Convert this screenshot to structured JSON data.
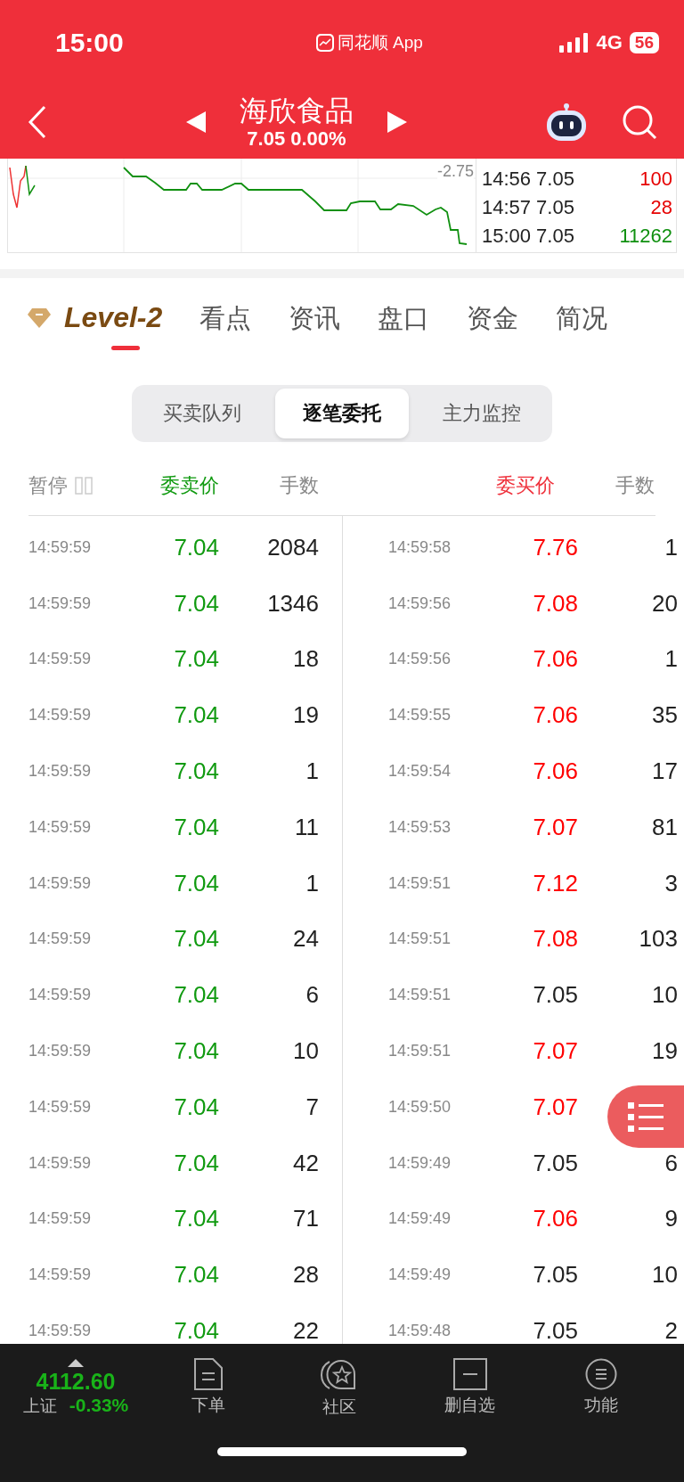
{
  "status_bar": {
    "time": "15:00",
    "app_label": "同花顺 App",
    "network": "4G",
    "battery": "56"
  },
  "header": {
    "title": "海欣食品",
    "subtitle": "7.05 0.00%"
  },
  "chart": {
    "axis_label": "-2.75",
    "ticks": [
      {
        "time": "14:56",
        "price": "7.05",
        "volume": "100",
        "color": "#e60000"
      },
      {
        "time": "14:57",
        "price": "7.05",
        "volume": "28",
        "color": "#e60000"
      },
      {
        "time": "15:00",
        "price": "7.05",
        "volume": "11262",
        "color": "#109010"
      }
    ]
  },
  "tabs": [
    {
      "label": "Level-2",
      "kind": "premium",
      "selected": true
    },
    {
      "label": "看点",
      "kind": "plain",
      "selected": false
    },
    {
      "label": "资讯",
      "kind": "plain",
      "selected": false
    },
    {
      "label": "盘口",
      "kind": "plain",
      "selected": false
    },
    {
      "label": "资金",
      "kind": "plain",
      "selected": false
    },
    {
      "label": "简况",
      "kind": "plain",
      "selected": false
    }
  ],
  "segments": [
    {
      "label": "买卖队列",
      "selected": false
    },
    {
      "label": "逐笔委托",
      "selected": true
    },
    {
      "label": "主力监控",
      "selected": false
    }
  ],
  "columns": {
    "pause": "暂停",
    "sell_price": "委卖价",
    "sell_qty": "手数",
    "buy_price": "委买价",
    "buy_qty": "手数"
  },
  "sell_orders": [
    {
      "time": "14:59:59",
      "price": "7.04",
      "qty": "2084"
    },
    {
      "time": "14:59:59",
      "price": "7.04",
      "qty": "1346"
    },
    {
      "time": "14:59:59",
      "price": "7.04",
      "qty": "18"
    },
    {
      "time": "14:59:59",
      "price": "7.04",
      "qty": "19"
    },
    {
      "time": "14:59:59",
      "price": "7.04",
      "qty": "1"
    },
    {
      "time": "14:59:59",
      "price": "7.04",
      "qty": "11"
    },
    {
      "time": "14:59:59",
      "price": "7.04",
      "qty": "1"
    },
    {
      "time": "14:59:59",
      "price": "7.04",
      "qty": "24"
    },
    {
      "time": "14:59:59",
      "price": "7.04",
      "qty": "6"
    },
    {
      "time": "14:59:59",
      "price": "7.04",
      "qty": "10"
    },
    {
      "time": "14:59:59",
      "price": "7.04",
      "qty": "7"
    },
    {
      "time": "14:59:59",
      "price": "7.04",
      "qty": "42"
    },
    {
      "time": "14:59:59",
      "price": "7.04",
      "qty": "71"
    },
    {
      "time": "14:59:59",
      "price": "7.04",
      "qty": "28"
    },
    {
      "time": "14:59:59",
      "price": "7.04",
      "qty": "22"
    }
  ],
  "buy_orders": [
    {
      "time": "14:59:58",
      "price": "7.76",
      "qty": "1",
      "color": "#ff0000"
    },
    {
      "time": "14:59:56",
      "price": "7.08",
      "qty": "20",
      "color": "#ff0000"
    },
    {
      "time": "14:59:56",
      "price": "7.06",
      "qty": "1",
      "color": "#ff0000"
    },
    {
      "time": "14:59:55",
      "price": "7.06",
      "qty": "35",
      "color": "#ff0000"
    },
    {
      "time": "14:59:54",
      "price": "7.06",
      "qty": "17",
      "color": "#ff0000"
    },
    {
      "time": "14:59:53",
      "price": "7.07",
      "qty": "81",
      "color": "#ff0000"
    },
    {
      "time": "14:59:51",
      "price": "7.12",
      "qty": "3",
      "color": "#ff0000"
    },
    {
      "time": "14:59:51",
      "price": "7.08",
      "qty": "103",
      "color": "#ff0000"
    },
    {
      "time": "14:59:51",
      "price": "7.05",
      "qty": "10",
      "color": "#222222"
    },
    {
      "time": "14:59:51",
      "price": "7.07",
      "qty": "19",
      "color": "#ff0000"
    },
    {
      "time": "14:59:50",
      "price": "7.07",
      "color": "#ff0000"
    },
    {
      "time": "14:59:49",
      "price": "7.05",
      "qty": "6",
      "color": "#222222"
    },
    {
      "time": "14:59:49",
      "price": "7.06",
      "qty": "9",
      "color": "#ff0000"
    },
    {
      "time": "14:59:49",
      "price": "7.05",
      "qty": "10",
      "color": "#222222"
    },
    {
      "time": "14:59:48",
      "price": "7.05",
      "qty": "2",
      "color": "#222222"
    }
  ],
  "index": {
    "value": "4112.60",
    "name": "上证",
    "change": "-0.33%"
  },
  "bottom_nav": [
    {
      "label": "下单"
    },
    {
      "label": "社区"
    },
    {
      "label": "删自选"
    },
    {
      "label": "功能"
    }
  ]
}
